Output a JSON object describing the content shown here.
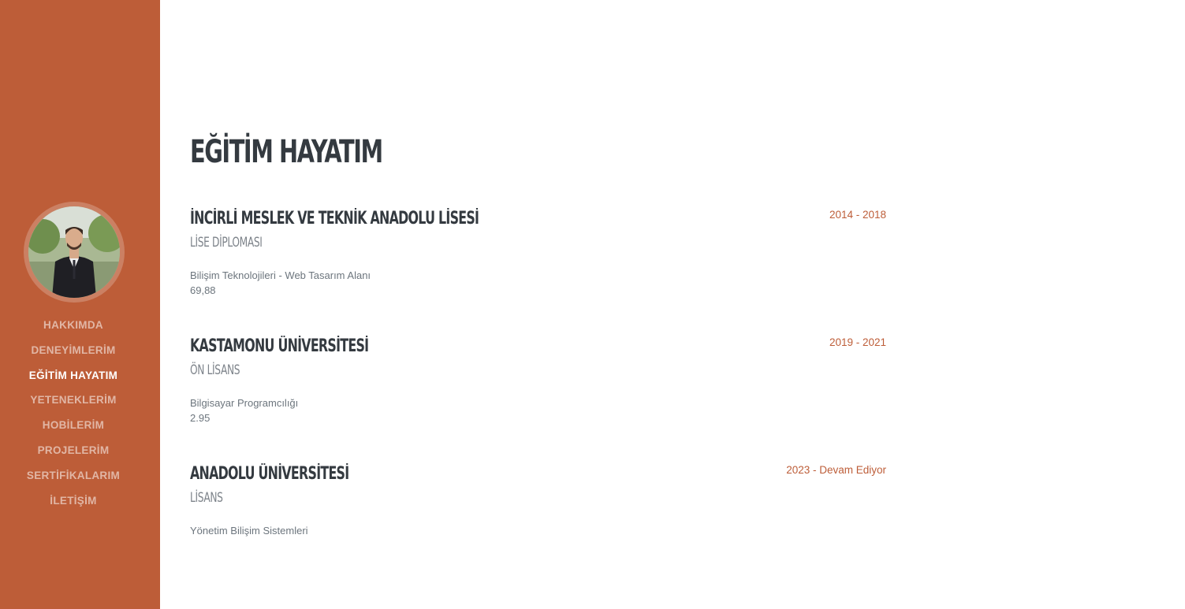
{
  "nav": {
    "items": [
      {
        "label": "HAKKIMDA"
      },
      {
        "label": "DENEYİMLERİM"
      },
      {
        "label": "EĞİTİM HAYATIM"
      },
      {
        "label": "YETENEKLERİM"
      },
      {
        "label": "HOBİLERİM"
      },
      {
        "label": "PROJELERİM"
      },
      {
        "label": "SERTİFİKALARIM"
      },
      {
        "label": "İLETİŞİM"
      }
    ],
    "active_label": "EĞİTİM HAYATIM"
  },
  "profile": {
    "avatar_icon": "profile-photo"
  },
  "main": {
    "title": "EĞİTİM HAYATIM",
    "education": [
      {
        "school": "İNCİRLİ MESLEK VE TEKNİK ANADOLU LİSESİ",
        "degree": "LİSE DİPLOMASI",
        "program": "Bilişim Teknolojileri - Web Tasarım Alanı",
        "grade": "69,88",
        "date": "2014 - 2018"
      },
      {
        "school": "KASTAMONU ÜNİVERSİTESİ",
        "degree": "ÖN LİSANS",
        "program": "Bilgisayar Programcılığı",
        "grade": "2.95",
        "date": "2019 - 2021"
      },
      {
        "school": "ANADOLU ÜNİVERSİTESİ",
        "degree": "LİSANS",
        "program": "Yönetim Bilişim Sistemleri",
        "grade": "",
        "date": "2023 - Devam Ediyor"
      }
    ]
  },
  "colors": {
    "sidebar": "#bd5d38",
    "accent": "#bd5d38",
    "heading": "#343a40",
    "muted": "#6c757d"
  }
}
